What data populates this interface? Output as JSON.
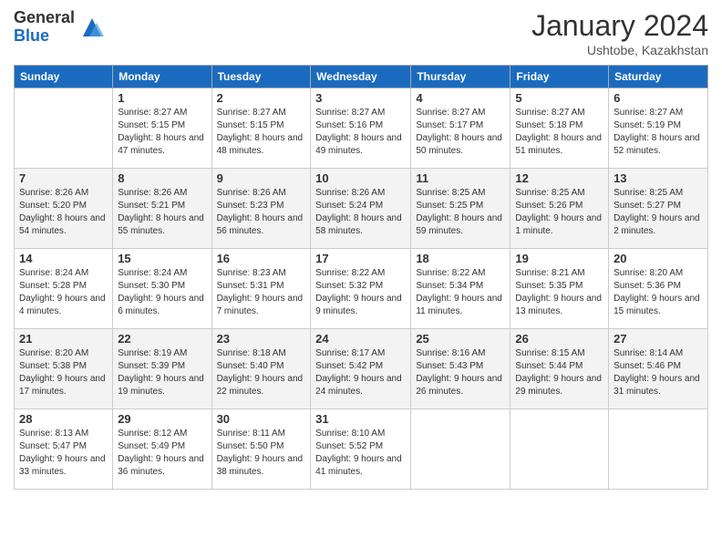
{
  "logo": {
    "general": "General",
    "blue": "Blue"
  },
  "header": {
    "month": "January 2024",
    "location": "Ushtobe, Kazakhstan"
  },
  "days_of_week": [
    "Sunday",
    "Monday",
    "Tuesday",
    "Wednesday",
    "Thursday",
    "Friday",
    "Saturday"
  ],
  "weeks": [
    [
      {
        "day": "",
        "sunrise": "",
        "sunset": "",
        "daylight": ""
      },
      {
        "day": "1",
        "sunrise": "Sunrise: 8:27 AM",
        "sunset": "Sunset: 5:15 PM",
        "daylight": "Daylight: 8 hours and 47 minutes."
      },
      {
        "day": "2",
        "sunrise": "Sunrise: 8:27 AM",
        "sunset": "Sunset: 5:15 PM",
        "daylight": "Daylight: 8 hours and 48 minutes."
      },
      {
        "day": "3",
        "sunrise": "Sunrise: 8:27 AM",
        "sunset": "Sunset: 5:16 PM",
        "daylight": "Daylight: 8 hours and 49 minutes."
      },
      {
        "day": "4",
        "sunrise": "Sunrise: 8:27 AM",
        "sunset": "Sunset: 5:17 PM",
        "daylight": "Daylight: 8 hours and 50 minutes."
      },
      {
        "day": "5",
        "sunrise": "Sunrise: 8:27 AM",
        "sunset": "Sunset: 5:18 PM",
        "daylight": "Daylight: 8 hours and 51 minutes."
      },
      {
        "day": "6",
        "sunrise": "Sunrise: 8:27 AM",
        "sunset": "Sunset: 5:19 PM",
        "daylight": "Daylight: 8 hours and 52 minutes."
      }
    ],
    [
      {
        "day": "7",
        "sunrise": "Sunrise: 8:26 AM",
        "sunset": "Sunset: 5:20 PM",
        "daylight": "Daylight: 8 hours and 54 minutes."
      },
      {
        "day": "8",
        "sunrise": "Sunrise: 8:26 AM",
        "sunset": "Sunset: 5:21 PM",
        "daylight": "Daylight: 8 hours and 55 minutes."
      },
      {
        "day": "9",
        "sunrise": "Sunrise: 8:26 AM",
        "sunset": "Sunset: 5:23 PM",
        "daylight": "Daylight: 8 hours and 56 minutes."
      },
      {
        "day": "10",
        "sunrise": "Sunrise: 8:26 AM",
        "sunset": "Sunset: 5:24 PM",
        "daylight": "Daylight: 8 hours and 58 minutes."
      },
      {
        "day": "11",
        "sunrise": "Sunrise: 8:25 AM",
        "sunset": "Sunset: 5:25 PM",
        "daylight": "Daylight: 8 hours and 59 minutes."
      },
      {
        "day": "12",
        "sunrise": "Sunrise: 8:25 AM",
        "sunset": "Sunset: 5:26 PM",
        "daylight": "Daylight: 9 hours and 1 minute."
      },
      {
        "day": "13",
        "sunrise": "Sunrise: 8:25 AM",
        "sunset": "Sunset: 5:27 PM",
        "daylight": "Daylight: 9 hours and 2 minutes."
      }
    ],
    [
      {
        "day": "14",
        "sunrise": "Sunrise: 8:24 AM",
        "sunset": "Sunset: 5:28 PM",
        "daylight": "Daylight: 9 hours and 4 minutes."
      },
      {
        "day": "15",
        "sunrise": "Sunrise: 8:24 AM",
        "sunset": "Sunset: 5:30 PM",
        "daylight": "Daylight: 9 hours and 6 minutes."
      },
      {
        "day": "16",
        "sunrise": "Sunrise: 8:23 AM",
        "sunset": "Sunset: 5:31 PM",
        "daylight": "Daylight: 9 hours and 7 minutes."
      },
      {
        "day": "17",
        "sunrise": "Sunrise: 8:22 AM",
        "sunset": "Sunset: 5:32 PM",
        "daylight": "Daylight: 9 hours and 9 minutes."
      },
      {
        "day": "18",
        "sunrise": "Sunrise: 8:22 AM",
        "sunset": "Sunset: 5:34 PM",
        "daylight": "Daylight: 9 hours and 11 minutes."
      },
      {
        "day": "19",
        "sunrise": "Sunrise: 8:21 AM",
        "sunset": "Sunset: 5:35 PM",
        "daylight": "Daylight: 9 hours and 13 minutes."
      },
      {
        "day": "20",
        "sunrise": "Sunrise: 8:20 AM",
        "sunset": "Sunset: 5:36 PM",
        "daylight": "Daylight: 9 hours and 15 minutes."
      }
    ],
    [
      {
        "day": "21",
        "sunrise": "Sunrise: 8:20 AM",
        "sunset": "Sunset: 5:38 PM",
        "daylight": "Daylight: 9 hours and 17 minutes."
      },
      {
        "day": "22",
        "sunrise": "Sunrise: 8:19 AM",
        "sunset": "Sunset: 5:39 PM",
        "daylight": "Daylight: 9 hours and 19 minutes."
      },
      {
        "day": "23",
        "sunrise": "Sunrise: 8:18 AM",
        "sunset": "Sunset: 5:40 PM",
        "daylight": "Daylight: 9 hours and 22 minutes."
      },
      {
        "day": "24",
        "sunrise": "Sunrise: 8:17 AM",
        "sunset": "Sunset: 5:42 PM",
        "daylight": "Daylight: 9 hours and 24 minutes."
      },
      {
        "day": "25",
        "sunrise": "Sunrise: 8:16 AM",
        "sunset": "Sunset: 5:43 PM",
        "daylight": "Daylight: 9 hours and 26 minutes."
      },
      {
        "day": "26",
        "sunrise": "Sunrise: 8:15 AM",
        "sunset": "Sunset: 5:44 PM",
        "daylight": "Daylight: 9 hours and 29 minutes."
      },
      {
        "day": "27",
        "sunrise": "Sunrise: 8:14 AM",
        "sunset": "Sunset: 5:46 PM",
        "daylight": "Daylight: 9 hours and 31 minutes."
      }
    ],
    [
      {
        "day": "28",
        "sunrise": "Sunrise: 8:13 AM",
        "sunset": "Sunset: 5:47 PM",
        "daylight": "Daylight: 9 hours and 33 minutes."
      },
      {
        "day": "29",
        "sunrise": "Sunrise: 8:12 AM",
        "sunset": "Sunset: 5:49 PM",
        "daylight": "Daylight: 9 hours and 36 minutes."
      },
      {
        "day": "30",
        "sunrise": "Sunrise: 8:11 AM",
        "sunset": "Sunset: 5:50 PM",
        "daylight": "Daylight: 9 hours and 38 minutes."
      },
      {
        "day": "31",
        "sunrise": "Sunrise: 8:10 AM",
        "sunset": "Sunset: 5:52 PM",
        "daylight": "Daylight: 9 hours and 41 minutes."
      },
      {
        "day": "",
        "sunrise": "",
        "sunset": "",
        "daylight": ""
      },
      {
        "day": "",
        "sunrise": "",
        "sunset": "",
        "daylight": ""
      },
      {
        "day": "",
        "sunrise": "",
        "sunset": "",
        "daylight": ""
      }
    ]
  ]
}
